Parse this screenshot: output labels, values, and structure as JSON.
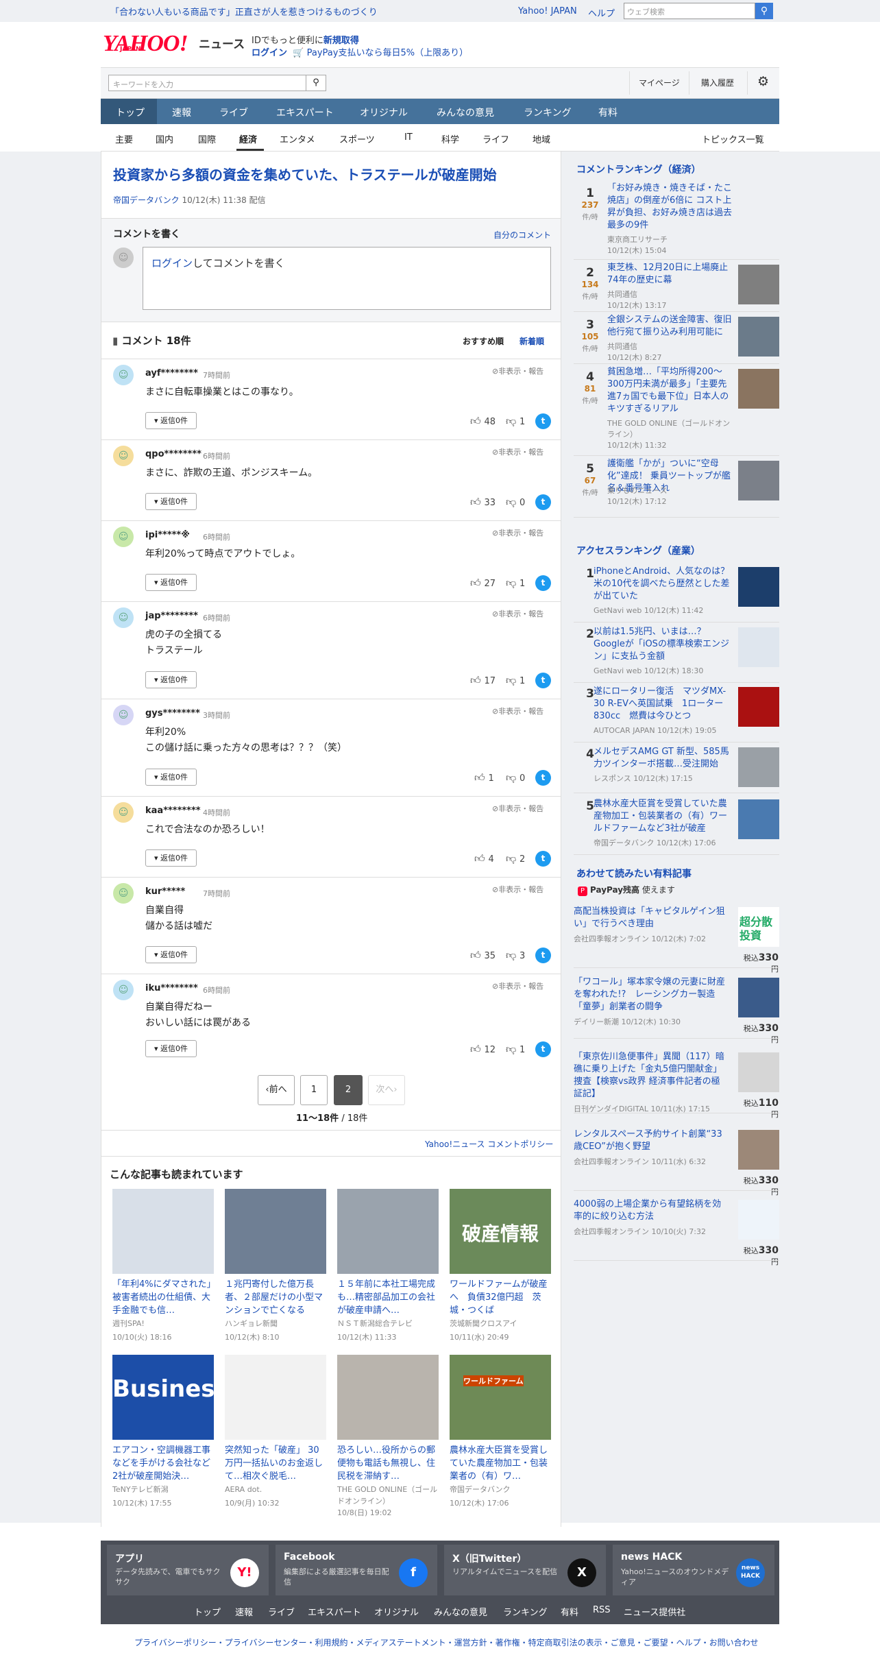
{
  "topbar": {
    "promo": "「合わない人もいる商品です」正直さが人を惹きつけるものづくり",
    "yahoo_japan": "Yahoo! JAPAN",
    "help": "ヘルプ",
    "search_placeholder": "ウェブ検索"
  },
  "header": {
    "logo": "YAHOO!",
    "logo_sub": "JAPAN",
    "news": "ニュース",
    "id_msg_prefix": "IDでもっと便利に",
    "id_msg_link": "新規取得",
    "login": "ログイン",
    "paypay": "PayPay支払いなら毎日5%（上限あり）"
  },
  "subheader": {
    "keyword_placeholder": "キーワードを入力",
    "mypage": "マイページ",
    "history": "購入履歴"
  },
  "main_nav": [
    "トップ",
    "速報",
    "ライブ",
    "エキスパート",
    "オリジナル",
    "みんなの意見",
    "ランキング",
    "有料"
  ],
  "cat_nav": [
    "主要",
    "国内",
    "国際",
    "経済",
    "エンタメ",
    "スポーツ",
    "IT",
    "科学",
    "ライフ",
    "地域"
  ],
  "topics_list": "トピックス一覧",
  "article": {
    "title": "投資家から多額の資金を集めていた、トラステールが破産開始",
    "source": "帝国データバンク",
    "date": "10/12(木) 11:38",
    "posted": "配信"
  },
  "write_comment": {
    "heading": "コメントを書く",
    "my_comments": "自分のコメント",
    "login_link": "ログイン",
    "prompt": "してコメントを書く"
  },
  "comments": {
    "count_label": "コメント 18件",
    "sort_recommended": "おすすめ順",
    "sort_newest": "新着順",
    "hide_report": "非表示・報告",
    "reply_label": "返信0件",
    "items": [
      {
        "user": "ayf********",
        "time": "7時間前",
        "lines": [
          "まさに自転車操業とはこの事なり。"
        ],
        "up": "48",
        "down": "1"
      },
      {
        "user": "qpo********",
        "time": "6時間前",
        "lines": [
          "まさに、詐欺の王道、ポンジスキーム。"
        ],
        "up": "33",
        "down": "0"
      },
      {
        "user": "ipi*****※",
        "time": "6時間前",
        "lines": [
          "年利20%って時点でアウトでしょ。"
        ],
        "up": "27",
        "down": "1"
      },
      {
        "user": "jap********",
        "time": "6時間前",
        "lines": [
          "虎の子の全損てる",
          "トラステール"
        ],
        "up": "17",
        "down": "1"
      },
      {
        "user": "gys********",
        "time": "3時間前",
        "lines": [
          "年利20%",
          "この儲け話に乗った方々の思考は？？？（笑）"
        ],
        "up": "1",
        "down": "0"
      },
      {
        "user": "kaa********",
        "time": "4時間前",
        "lines": [
          "これで合法なのか恐ろしい！"
        ],
        "up": "4",
        "down": "2"
      },
      {
        "user": "kur*****",
        "time": "7時間前",
        "lines": [
          "自業自得",
          "儲かる話は嘘だ"
        ],
        "up": "35",
        "down": "3"
      },
      {
        "user": "iku********",
        "time": "6時間前",
        "lines": [
          "自業自得だねー",
          "おいしい話には罠がある"
        ],
        "up": "12",
        "down": "1"
      }
    ]
  },
  "pager": {
    "prev": "前へ",
    "p1": "1",
    "p2": "2",
    "next": "次へ",
    "range": "11〜18件",
    "total": "/ 18件"
  },
  "policy": "Yahoo!ニュース コメントポリシー",
  "read_also": {
    "heading": "こんな記事も読まれています",
    "items": [
      {
        "title": "「年利4%にダマされた」被害者続出の仕組債、大手金融でも信…",
        "source": "週刊SPA!",
        "date": "10/10(火) 18:16"
      },
      {
        "title": "１兆円寄付した億万長者、２部屋だけの小型マンションで亡くなる",
        "source": "ハンギョレ新聞",
        "date": "10/12(木) 8:10"
      },
      {
        "title": "１５年前に本社工場完成も…精密部品加工の会社が破産申請へ…",
        "source": "ＮＳＴ新潟総合テレビ",
        "date": "10/12(木) 11:33"
      },
      {
        "title": "ワールドファームが破産へ　負債32億円超　茨城・つくば",
        "source": "茨城新聞クロスアイ",
        "date": "10/11(水) 20:49"
      },
      {
        "title": "エアコン・空調機器工事などを手がける会社など2社が破産開始決…",
        "source": "TeNYテレビ新潟",
        "date": "10/12(木) 17:55"
      },
      {
        "title": "突然知った「破産」 30万円一括払いのお金返して…相次ぐ脱毛…",
        "source": "AERA dot.",
        "date": "10/9(月) 10:32"
      },
      {
        "title": "恐ろしい…役所からの郵便物も電話も無視し、住民税を滞納す…",
        "source": "THE GOLD ONLINE（ゴールドオンライン）",
        "date": "10/8(日) 19:02"
      },
      {
        "title": "農林水産大臣賞を受賞していた農産物加工・包装業者の（有）ワ…",
        "source": "帝国データバンク",
        "date": "10/12(木) 17:06"
      }
    ],
    "img_text": {
      "bankrupt": "破産情報",
      "business": "Business",
      "farm": "ワールドファーム"
    }
  },
  "comment_ranking": {
    "heading": "コメントランキング（経済）",
    "unit": "件/時",
    "items": [
      {
        "rank": "1",
        "count": "237",
        "title": "「お好み焼き・焼きそば・たこ焼店」の倒産が6倍に コスト上昇が負担、お好み焼き店は過去最多の9件",
        "source": "東京商工リサーチ",
        "date": "10/12(木) 15:04"
      },
      {
        "rank": "2",
        "count": "134",
        "title": "東芝株、12月20日に上場廃止 74年の歴史に幕",
        "source": "共同通信",
        "date": "10/12(木) 13:17"
      },
      {
        "rank": "3",
        "count": "105",
        "title": "全銀システムの送金障害、復旧 他行宛て振り込み利用可能に",
        "source": "共同通信",
        "date": "10/12(木) 8:27"
      },
      {
        "rank": "4",
        "count": "81",
        "title": "貧困急増…「平均所得200〜300万円未満が最多」「主要先進7ヵ国でも最下位」日本人のキツすぎるリアル",
        "source": "THE GOLD ONLINE（ゴールドオンライン）",
        "date": "10/12(木) 11:32"
      },
      {
        "rank": "5",
        "count": "67",
        "title": "護衛艦「かが」ついに“空母化”達成！ 乗員ツートップが艦名＆番号筆入れ",
        "source": "乗りものニュース",
        "date": "10/12(木) 17:12"
      }
    ]
  },
  "access_ranking": {
    "heading": "アクセスランキング（産業）",
    "items": [
      {
        "rank": "1",
        "title": "iPhoneとAndroid、人気なのは？米の10代を調べたら歴然とした差が出ていた",
        "meta": "GetNavi web 10/12(木) 11:42"
      },
      {
        "rank": "2",
        "title": "以前は1.5兆円、いまは…？Googleが「iOSの標準検索エンジン」に支払う金額",
        "meta": "GetNavi web 10/12(木) 18:30"
      },
      {
        "rank": "3",
        "title": "遂にロータリー復活　マツダMX-30 R-EVへ英国試乗　1ローター830cc　燃費は今ひとつ",
        "meta": "AUTOCAR JAPAN 10/12(木) 19:05"
      },
      {
        "rank": "4",
        "title": "メルセデスAMG GT 新型、585馬力ツインターボ搭載…受注開始",
        "meta": "レスポンス 10/12(木) 17:15"
      },
      {
        "rank": "5",
        "title": "農林水産大臣賞を受賞していた農産物加工・包装業者の（有）ワールドファームなど3社が破産",
        "meta": "帝国データバンク 10/12(木) 17:06"
      }
    ]
  },
  "paid": {
    "heading": "あわせて読みたい有料記事",
    "paypay_label": "PayPay残高",
    "paypay_suffix": "使えます",
    "tax": "税込",
    "yen": "円",
    "items": [
      {
        "title": "高配当株投資は「キャピタルゲイン狙い」で行うべき理由",
        "meta": "会社四季報オンライン 10/12(木) 7:02",
        "price": "330"
      },
      {
        "title": "「ワコール」塚本家令嬢の元妻に財産を奪われた!?　レーシングカー製造「童夢」創業者の闘争",
        "meta": "デイリー新潮 10/12(木) 10:30",
        "price": "330"
      },
      {
        "title": "「東京佐川急便事件」異聞（117）暗礁に乗り上げた「金丸5億円闇献金」捜査【検察vs政界 経済事件記者の極証記】",
        "meta": "日刊ゲンダイDIGITAL 10/11(水) 17:15",
        "price": "110"
      },
      {
        "title": "レンタルスペース予約サイト創業“33歳CEO”が抱く野望",
        "meta": "会社四季報オンライン 10/11(水) 6:32",
        "price": "330"
      },
      {
        "title": "4000弱の上場企業から有望銘柄を効率的に絞り込む方法",
        "meta": "会社四季報オンライン 10/10(火) 7:32",
        "price": "330"
      }
    ],
    "thumb1_text": "超分散投資"
  },
  "footer": {
    "cards": [
      {
        "title": "アプリ",
        "desc": "データ先読みで、電車でもサクサク",
        "icon": "Y!"
      },
      {
        "title": "Facebook",
        "desc": "編集部による厳選記事を毎日配信",
        "icon": "f"
      },
      {
        "title": "X（旧Twitter）",
        "desc": "リアルタイムでニュースを配信",
        "icon": "X"
      },
      {
        "title": "news HACK",
        "desc": "Yahoo!ニュースのオウンドメディア",
        "icon": "news HACK"
      }
    ],
    "nav": [
      "トップ",
      "速報",
      "ライブ",
      "エキスパート",
      "オリジナル",
      "みんなの意見",
      "ランキング",
      "有料",
      "RSS",
      "ニュース提供社"
    ],
    "bottom_links": "プライバシーポリシー・プライバシーセンター・利用規約・メディアステートメント・運営方針・著作権・特定商取引法の表示・ご意見・ご要望・ヘルプ・お問い合わせ"
  },
  "colors": {
    "accent": "#1a4eb5",
    "nav": "#45729b",
    "twitter": "#1d9bf0",
    "yahoo_red": "#ff0033"
  }
}
